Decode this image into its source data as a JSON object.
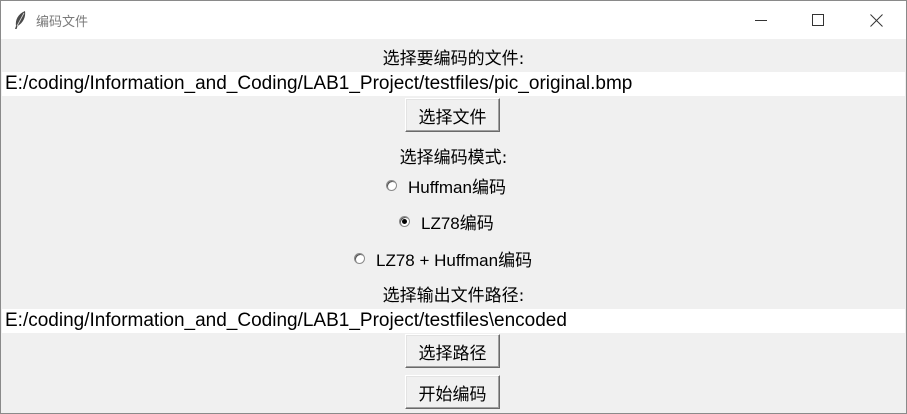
{
  "window": {
    "title": "编码文件",
    "icon": "feather-icon",
    "controls": [
      "minimize-icon",
      "maximize-icon",
      "close-icon"
    ]
  },
  "input_section": {
    "label": "选择要编码的文件:",
    "path_value": "E:/coding/Information_and_Coding/LAB1_Project/testfiles/pic_original.bmp",
    "browse_label": "选择文件"
  },
  "mode_section": {
    "label": "选择编码模式:",
    "options": [
      {
        "label": "Huffman编码",
        "selected": false
      },
      {
        "label": "LZ78编码",
        "selected": true
      },
      {
        "label": "LZ78 + Huffman编码",
        "selected": false
      }
    ]
  },
  "output_section": {
    "label": "选择输出文件路径:",
    "path_value": "E:/coding/Information_and_Coding/LAB1_Project/testfiles\\encoded",
    "browse_label": "选择路径"
  },
  "actions": {
    "start_label": "开始编码"
  }
}
